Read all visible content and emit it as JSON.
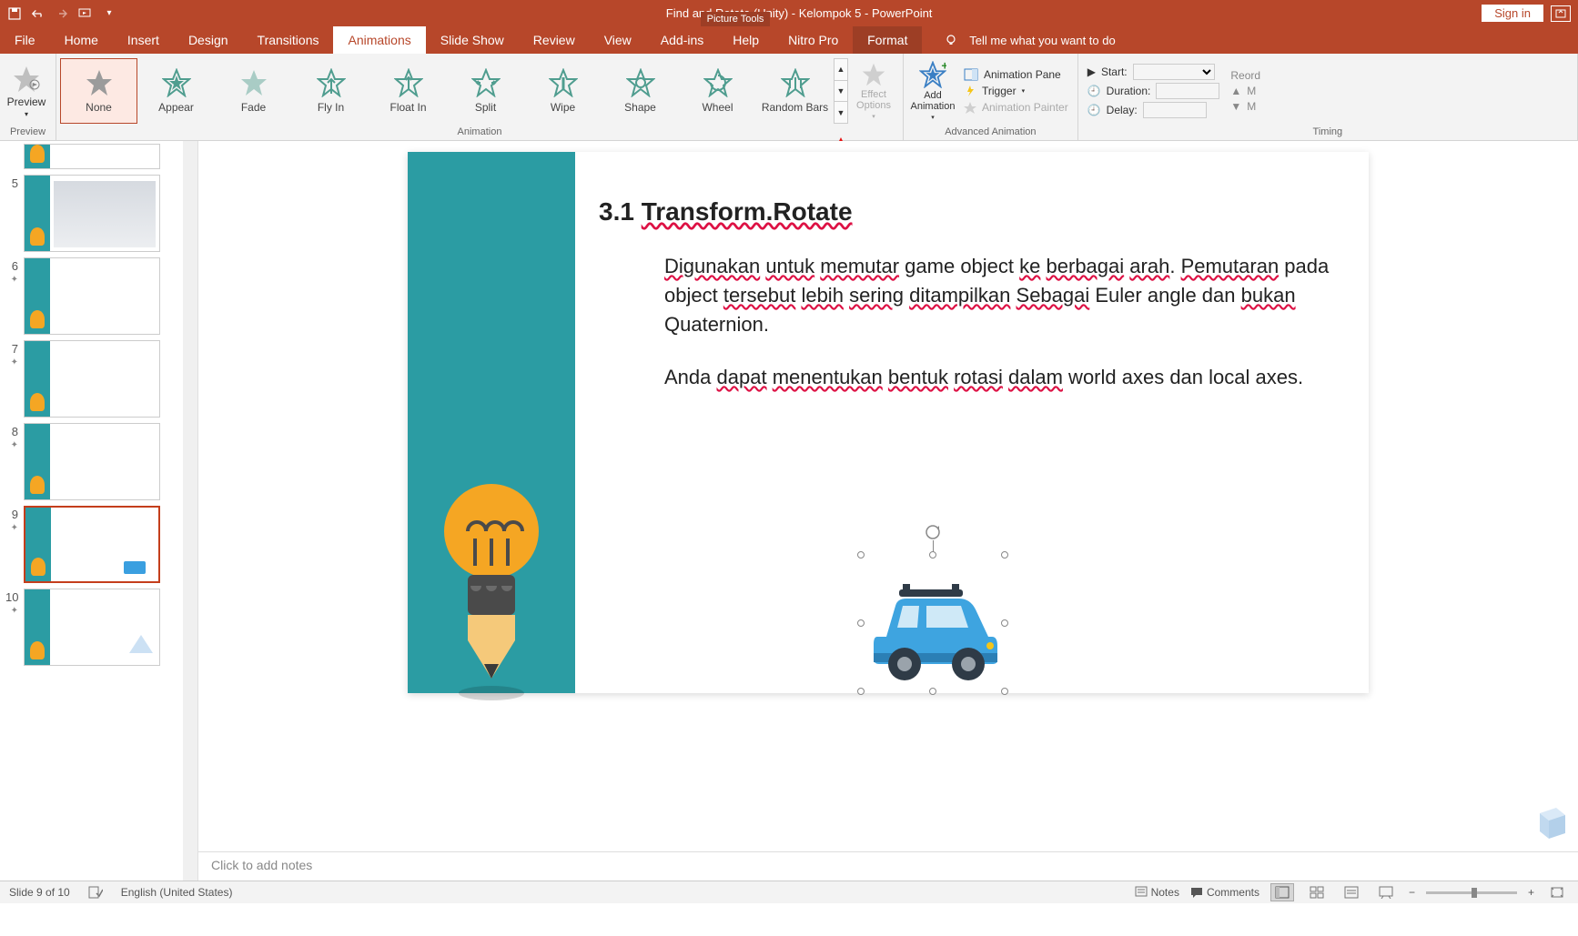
{
  "titlebar": {
    "title": "Find and Rotate (Unity) - Kelompok 5  -  PowerPoint",
    "signin": "Sign in",
    "context_group": "Picture Tools"
  },
  "tabs": {
    "file": "File",
    "home": "Home",
    "insert": "Insert",
    "design": "Design",
    "transitions": "Transitions",
    "animations": "Animations",
    "slideshow": "Slide Show",
    "review": "Review",
    "view": "View",
    "addins": "Add-ins",
    "help": "Help",
    "nitro": "Nitro Pro",
    "format": "Format",
    "tellme": "Tell me what you want to do"
  },
  "ribbon": {
    "preview": {
      "label": "Preview",
      "group": "Preview"
    },
    "animation": {
      "group": "Animation",
      "items": [
        "None",
        "Appear",
        "Fade",
        "Fly In",
        "Float In",
        "Split",
        "Wipe",
        "Shape",
        "Wheel",
        "Random Bars"
      ],
      "effect_options": "Effect Options"
    },
    "advanced": {
      "group": "Advanced Animation",
      "add_animation": "Add Animation",
      "pane": "Animation Pane",
      "trigger": "Trigger",
      "painter": "Animation Painter"
    },
    "timing": {
      "group": "Timing",
      "start": "Start:",
      "duration": "Duration:",
      "delay": "Delay:",
      "reorder": "Reord",
      "move_earlier": "M",
      "move_later": "M"
    }
  },
  "thumbnails": {
    "slides": [
      {
        "num": "5",
        "star": false
      },
      {
        "num": "6",
        "star": true
      },
      {
        "num": "7",
        "star": true
      },
      {
        "num": "8",
        "star": true
      },
      {
        "num": "9",
        "star": true,
        "active": true
      },
      {
        "num": "10",
        "star": true
      }
    ],
    "partial_num": ""
  },
  "slide": {
    "title_prefix": "3.1 ",
    "title_underlined": "Transform.Rotate",
    "p1": "Digunakan untuk memutar game object ke berbagai arah. Pemutaran pada object tersebut lebih sering ditampilkan Sebagai Euler angle dan bukan Quaternion.",
    "p2": "Anda dapat menentukan bentuk rotasi dalam world axes dan local axes."
  },
  "notes": {
    "placeholder": "Click to add notes"
  },
  "status": {
    "slide_info": "Slide 9 of 10",
    "language": "English (United States)",
    "notes": "Notes",
    "comments": "Comments"
  },
  "colors": {
    "accent": "#b7472a",
    "teal": "#2b9ca3",
    "star_green": "#4f9d8f",
    "star_gray": "#bfbfbf"
  }
}
